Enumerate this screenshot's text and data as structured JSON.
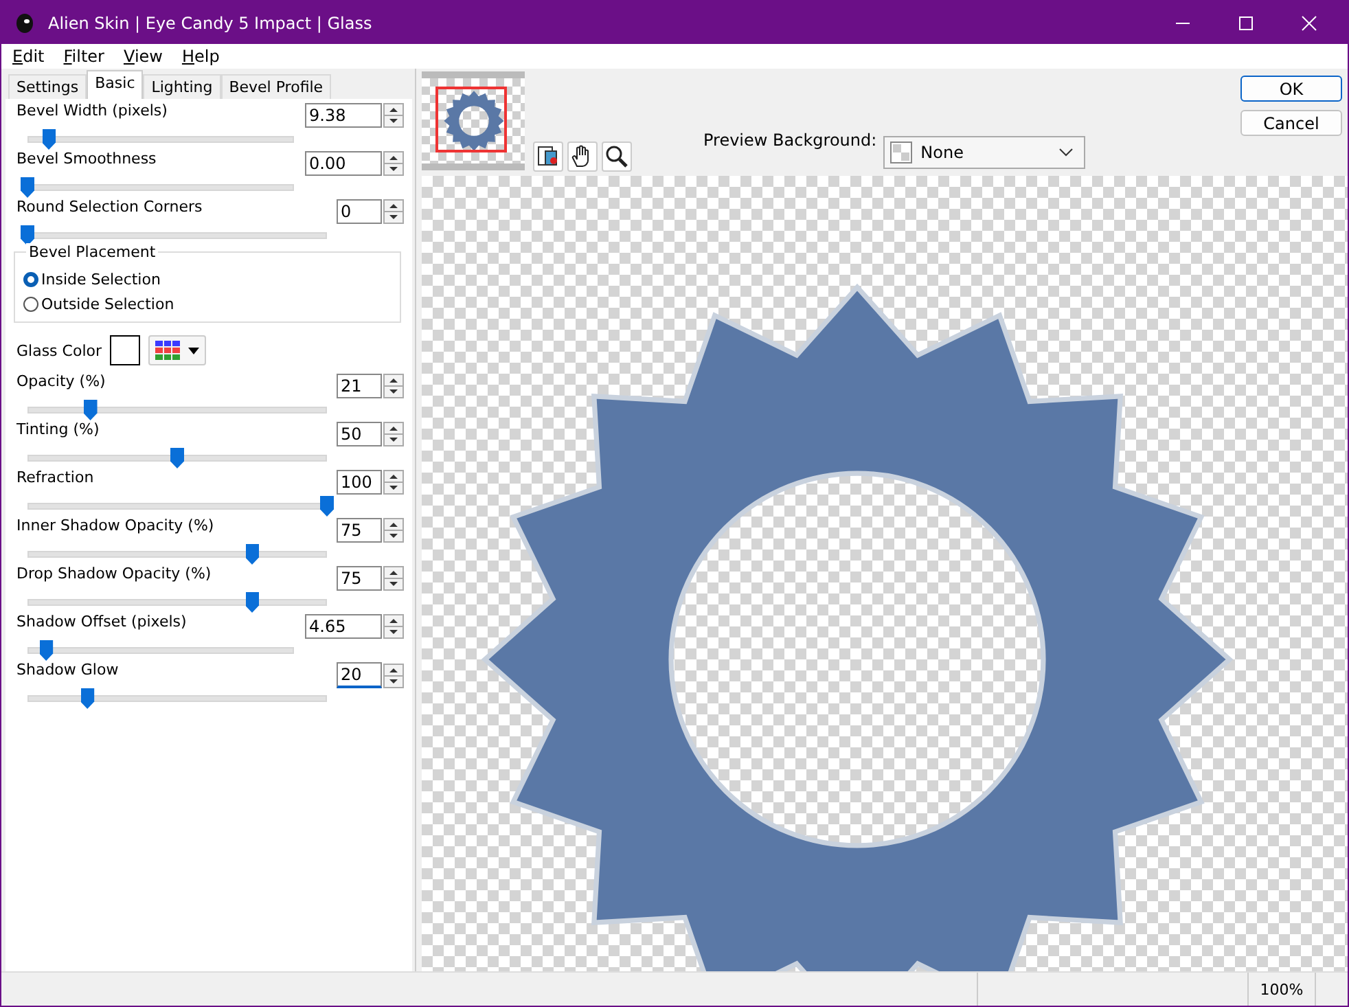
{
  "window": {
    "title": "Alien Skin | Eye Candy 5 Impact | Glass"
  },
  "menu": [
    {
      "label": "Edit"
    },
    {
      "label": "Filter"
    },
    {
      "label": "View"
    },
    {
      "label": "Help"
    }
  ],
  "tabs": [
    {
      "label": "Settings",
      "selected": false
    },
    {
      "label": "Basic",
      "selected": true
    },
    {
      "label": "Lighting",
      "selected": false
    },
    {
      "label": "Bevel Profile",
      "selected": false
    }
  ],
  "sliders_top": [
    {
      "label": "Bevel Width (pixels)",
      "value": "9.38",
      "kind": "decimal",
      "level": 0.08,
      "focused": false
    },
    {
      "label": "Bevel Smoothness",
      "value": "0.00",
      "kind": "decimal",
      "level": 0,
      "focused": false
    },
    {
      "label": "Round Selection Corners",
      "value": "0",
      "kind": "integer",
      "level": 0,
      "focused": false
    }
  ],
  "bevel_placement": {
    "title": "Bevel Placement",
    "options": [
      {
        "label": "Inside Selection",
        "selected": true
      },
      {
        "label": "Outside Selection",
        "selected": false
      }
    ]
  },
  "glass_color": {
    "label": "Glass Color",
    "color": "#ffffff"
  },
  "sliders_bottom": [
    {
      "label": "Opacity (%)",
      "value": "21",
      "kind": "integer",
      "level": 0.21,
      "focused": false
    },
    {
      "label": "Tinting (%)",
      "value": "50",
      "kind": "integer",
      "level": 0.5,
      "focused": false
    },
    {
      "label": "Refraction",
      "value": "100",
      "kind": "integer",
      "level": 1,
      "focused": false
    },
    {
      "label": "Inner Shadow Opacity (%)",
      "value": "75",
      "kind": "integer",
      "level": 0.75,
      "focused": false
    },
    {
      "label": "Drop Shadow Opacity (%)",
      "value": "75",
      "kind": "integer",
      "level": 0.75,
      "focused": false
    },
    {
      "label": "Shadow Offset (pixels)",
      "value": "4.65",
      "kind": "decimal",
      "level": 0.07,
      "focused": false
    },
    {
      "label": "Shadow Glow",
      "value": "20",
      "kind": "integer",
      "level": 0.2,
      "focused": true
    }
  ],
  "preview": {
    "background_label": "Preview Background:",
    "background_value": "None"
  },
  "buttons": [
    {
      "label": "OK",
      "default": true
    },
    {
      "label": "Cancel",
      "default": false
    }
  ],
  "status_bar": {
    "zoom": "100%"
  }
}
